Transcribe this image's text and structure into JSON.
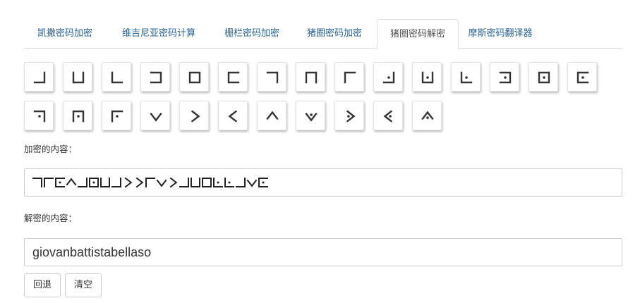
{
  "tabs": [
    {
      "label": "凯撒密码加密",
      "active": false
    },
    {
      "label": "维吉尼亚密码计算",
      "active": false
    },
    {
      "label": "栅栏密码加密",
      "active": false
    },
    {
      "label": "猪圈密码加密",
      "active": false
    },
    {
      "label": "猪圈密码解密",
      "active": true
    },
    {
      "label": "摩斯密码翻译器",
      "active": false
    }
  ],
  "pigpen_keys": [
    {
      "icon": "pigpen-grid-a-icon",
      "letter": "a"
    },
    {
      "icon": "pigpen-grid-b-icon",
      "letter": "b"
    },
    {
      "icon": "pigpen-grid-c-icon",
      "letter": "c"
    },
    {
      "icon": "pigpen-grid-d-icon",
      "letter": "d"
    },
    {
      "icon": "pigpen-grid-e-icon",
      "letter": "e"
    },
    {
      "icon": "pigpen-grid-f-icon",
      "letter": "f"
    },
    {
      "icon": "pigpen-grid-g-icon",
      "letter": "g"
    },
    {
      "icon": "pigpen-grid-h-icon",
      "letter": "h"
    },
    {
      "icon": "pigpen-grid-i-icon",
      "letter": "i"
    },
    {
      "icon": "pigpen-dotgrid-j-icon",
      "letter": "j"
    },
    {
      "icon": "pigpen-dotgrid-k-icon",
      "letter": "k"
    },
    {
      "icon": "pigpen-dotgrid-l-icon",
      "letter": "l"
    },
    {
      "icon": "pigpen-dotgrid-m-icon",
      "letter": "m"
    },
    {
      "icon": "pigpen-dotgrid-n-icon",
      "letter": "n"
    },
    {
      "icon": "pigpen-dotgrid-o-icon",
      "letter": "o"
    },
    {
      "icon": "pigpen-dotgrid-p-icon",
      "letter": "p"
    },
    {
      "icon": "pigpen-dotgrid-q-icon",
      "letter": "q"
    },
    {
      "icon": "pigpen-dotgrid-r-icon",
      "letter": "r"
    },
    {
      "icon": "pigpen-x-s-icon",
      "letter": "s"
    },
    {
      "icon": "pigpen-x-t-icon",
      "letter": "t"
    },
    {
      "icon": "pigpen-x-u-icon",
      "letter": "u"
    },
    {
      "icon": "pigpen-x-v-icon",
      "letter": "v"
    },
    {
      "icon": "pigpen-dotx-w-icon",
      "letter": "w"
    },
    {
      "icon": "pigpen-dotx-x-icon",
      "letter": "x"
    },
    {
      "icon": "pigpen-dotx-y-icon",
      "letter": "y"
    },
    {
      "icon": "pigpen-dotx-z-icon",
      "letter": "z"
    }
  ],
  "encrypted_label": "加密的内容：",
  "encrypted_symbols": "giovanbattistabellaso",
  "decrypted_label": "解密的内容：",
  "decrypted_value": "giovanbattistabellaso",
  "buttons": {
    "back": "回退",
    "clear": "清空"
  }
}
